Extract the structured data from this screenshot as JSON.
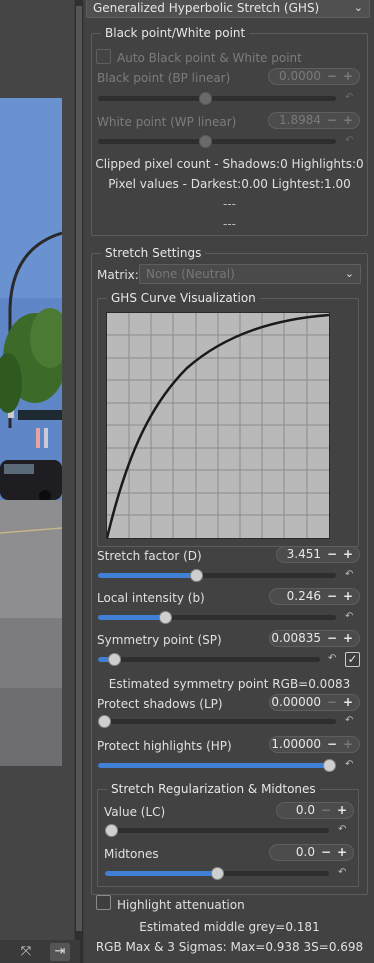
{
  "top_combo": {
    "value": "Generalized Hyperbolic Stretch (GHS)"
  },
  "bpwp": {
    "title": "Black point/White point",
    "auto_label": "Auto Black point & White point",
    "bp_label": "Black point (BP linear)",
    "bp_value": "0.0000",
    "bp_level": 0.45,
    "wp_label": "White point (WP linear)",
    "wp_value": "1.8984",
    "wp_level": 0.45,
    "clipped": "Clipped pixel count - Shadows:0 Highlights:0",
    "pixel_values": "Pixel values - Darkest:0.00 Lightest:1.00",
    "dash1": "---",
    "dash2": "---"
  },
  "stretch": {
    "title": "Stretch Settings",
    "matrix_label": "Matrix:",
    "matrix_value": "None (Neutral)",
    "curve_title": "GHS Curve Visualization",
    "stretch_factor_label": "Stretch factor (D)",
    "stretch_factor_value": "3.451",
    "stretch_factor_level": 0.41,
    "local_intensity_label": "Local intensity (b)",
    "local_intensity_value": "0.246",
    "local_intensity_level": 0.27,
    "symmetry_label": "Symmetry point (SP)",
    "symmetry_value": "0.00835",
    "symmetry_level": 0.05,
    "estimated_sp": "Estimated symmetry point RGB=0.0083",
    "protect_shadows_label": "Protect shadows (LP)",
    "protect_shadows_value": "0.00000",
    "protect_shadows_level": 0.0,
    "protect_highlights_label": "Protect highlights (HP)",
    "protect_highlights_value": "1.00000",
    "protect_highlights_level": 1.0
  },
  "regularization": {
    "title": "Stretch Regularization & Midtones",
    "value_label": "Value (LC)",
    "value_value": "0.0",
    "value_level": 0.0,
    "midtones_label": "Midtones",
    "midtones_value": "0.0",
    "midtones_level": 0.5
  },
  "highlight_attenuation_label": "Highlight attenuation",
  "estimated_grey": "Estimated middle grey=0.181",
  "rgb_max": "RGB Max & 3 Sigmas: Max=0.938 3S=0.698",
  "colors": {
    "accent": "#3f7fd6",
    "panel": "#424242"
  }
}
